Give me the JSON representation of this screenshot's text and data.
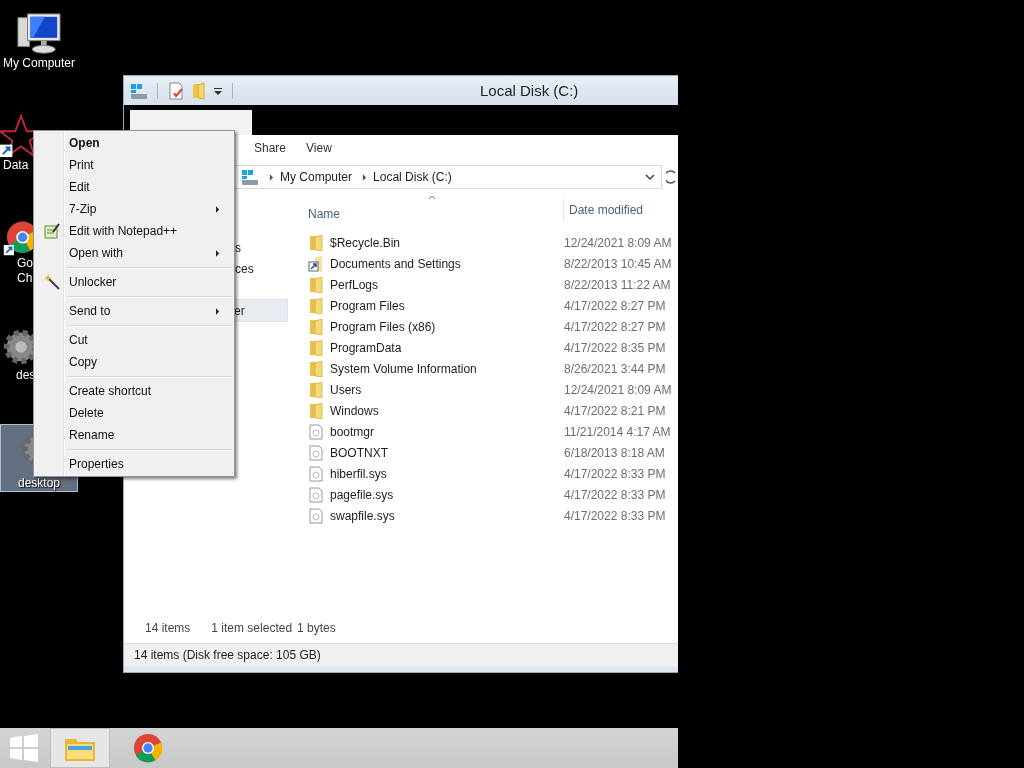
{
  "desktop_icons": [
    {
      "kind": "computer",
      "lines": [
        "My Computer"
      ],
      "selected": false
    },
    {
      "kind": "star-shortcut",
      "lines": [
        "Data"
      ],
      "selected": false
    },
    {
      "kind": "chrome-shortcut",
      "lines": [
        "Go",
        "Ch"
      ],
      "selected": false
    },
    {
      "kind": "gear",
      "lines": [
        "des"
      ],
      "selected": false
    },
    {
      "kind": "gear",
      "lines": [
        "desktop"
      ],
      "selected": true
    }
  ],
  "explorer": {
    "title": "Local Disk (C:)",
    "ribbon_tabs": [
      "Share",
      "View"
    ],
    "address": {
      "crumbs": [
        "My Computer",
        "Local Disk (C:)"
      ]
    },
    "nav_items": [
      {
        "label": "s",
        "selected": false
      },
      {
        "label": "ces",
        "selected": false
      },
      {
        "label": "er",
        "selected": true
      }
    ],
    "table": {
      "columns": [
        "Name",
        "Date modified"
      ],
      "rows": [
        {
          "kind": "folder",
          "name": "$Recycle.Bin",
          "date": "12/24/2021 8:09 AM"
        },
        {
          "kind": "shortcut",
          "name": "Documents and Settings",
          "date": "8/22/2013 10:45 AM"
        },
        {
          "kind": "folder",
          "name": "PerfLogs",
          "date": "8/22/2013 11:22 AM"
        },
        {
          "kind": "folder",
          "name": "Program Files",
          "date": "4/17/2022 8:27 PM"
        },
        {
          "kind": "folder",
          "name": "Program Files (x86)",
          "date": "4/17/2022 8:27 PM"
        },
        {
          "kind": "folder",
          "name": "ProgramData",
          "date": "4/17/2022 8:35 PM"
        },
        {
          "kind": "folder",
          "name": "System Volume Information",
          "date": "8/26/2021 3:44 PM"
        },
        {
          "kind": "folder",
          "name": "Users",
          "date": "12/24/2021 8:09 AM"
        },
        {
          "kind": "folder",
          "name": "Windows",
          "date": "4/17/2022 8:21 PM"
        },
        {
          "kind": "file",
          "name": "bootmgr",
          "date": "11/21/2014 4:17 AM"
        },
        {
          "kind": "file",
          "name": "BOOTNXT",
          "date": "6/18/2013 8:18 AM"
        },
        {
          "kind": "file",
          "name": "hiberfil.sys",
          "date": "4/17/2022 8:33 PM"
        },
        {
          "kind": "file",
          "name": "pagefile.sys",
          "date": "4/17/2022 8:33 PM"
        },
        {
          "kind": "file",
          "name": "swapfile.sys",
          "date": "4/17/2022 8:33 PM"
        }
      ]
    },
    "details": [
      "14 items",
      "1 item selected",
      "1 bytes"
    ],
    "status_bar": "14 items (Disk free space: 105 GB)"
  },
  "context_menu": [
    {
      "kind": "item",
      "label": "Open",
      "default": true,
      "submenu": false
    },
    {
      "kind": "item",
      "label": "Print",
      "default": false,
      "submenu": false
    },
    {
      "kind": "item",
      "label": "Edit",
      "default": false,
      "submenu": false
    },
    {
      "kind": "item",
      "label": "7-Zip",
      "default": false,
      "submenu": true
    },
    {
      "kind": "notepad-item",
      "label": "Edit with Notepad++",
      "default": false,
      "submenu": false
    },
    {
      "kind": "item",
      "label": "Open with",
      "default": false,
      "submenu": true
    },
    {
      "kind": "separator"
    },
    {
      "kind": "wand-item",
      "label": "Unlocker",
      "default": false,
      "submenu": false
    },
    {
      "kind": "separator"
    },
    {
      "kind": "item",
      "label": "Send to",
      "default": false,
      "submenu": true
    },
    {
      "kind": "separator"
    },
    {
      "kind": "item",
      "label": "Cut",
      "default": false,
      "submenu": false
    },
    {
      "kind": "item",
      "label": "Copy",
      "default": false,
      "submenu": false
    },
    {
      "kind": "separator"
    },
    {
      "kind": "item",
      "label": "Create shortcut",
      "default": false,
      "submenu": false
    },
    {
      "kind": "item",
      "label": "Delete",
      "default": false,
      "submenu": false
    },
    {
      "kind": "item",
      "label": "Rename",
      "default": false,
      "submenu": false
    },
    {
      "kind": "separator"
    },
    {
      "kind": "item",
      "label": "Properties",
      "default": false,
      "submenu": false
    }
  ],
  "taskbar": {
    "pinned": [
      {
        "kind": "explorer",
        "active": true
      },
      {
        "kind": "chrome",
        "active": false
      }
    ]
  }
}
